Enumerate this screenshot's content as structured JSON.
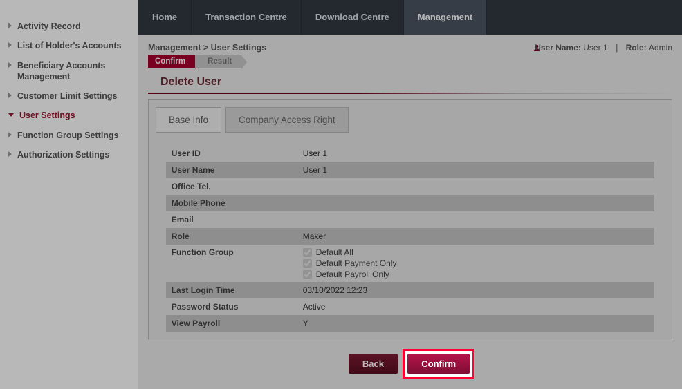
{
  "sidebar": {
    "items": [
      {
        "label": "Activity Record",
        "active": false
      },
      {
        "label": "List of Holder's Accounts",
        "active": false
      },
      {
        "label": "Beneficiary Accounts Management",
        "active": false
      },
      {
        "label": "Customer Limit Settings",
        "active": false
      },
      {
        "label": "User Settings",
        "active": true
      },
      {
        "label": "Function Group Settings",
        "active": false
      },
      {
        "label": "Authorization Settings",
        "active": false
      }
    ]
  },
  "topnav": {
    "items": [
      {
        "label": "Home",
        "active": false
      },
      {
        "label": "Transaction Centre",
        "active": false
      },
      {
        "label": "Download Centre",
        "active": false
      },
      {
        "label": "Management",
        "active": true
      }
    ]
  },
  "breadcrumb": {
    "text": "Management > User Settings"
  },
  "meta": {
    "user_name_label": "User Name:",
    "user_name_value": "User 1",
    "role_label": "Role:",
    "role_value": "Admin"
  },
  "wizard": {
    "confirm_label": "Confirm",
    "result_label": "Result"
  },
  "page": {
    "title": "Delete User"
  },
  "tabs": {
    "base_info": "Base Info",
    "company_access": "Company Access Right"
  },
  "info": {
    "rows": [
      {
        "label": "User ID",
        "value": "User 1",
        "shade": false
      },
      {
        "label": "User Name",
        "value": "User 1",
        "shade": true
      },
      {
        "label": "Office Tel.",
        "value": "",
        "shade": false
      },
      {
        "label": "Mobile Phone",
        "value": "",
        "shade": true
      },
      {
        "label": "Email",
        "value": "",
        "shade": false
      },
      {
        "label": "Role",
        "value": "Maker",
        "shade": true
      }
    ],
    "function_group_label": "Function Group",
    "function_groups": [
      {
        "label": "Default All",
        "checked": true
      },
      {
        "label": "Default Payment Only",
        "checked": true
      },
      {
        "label": "Default Payroll Only",
        "checked": true
      }
    ],
    "rows2": [
      {
        "label": "Last Login Time",
        "value": "03/10/2022 12:23",
        "shade": true
      },
      {
        "label": "Password Status",
        "value": "Active",
        "shade": false
      },
      {
        "label": "View Payroll",
        "value": "Y",
        "shade": true
      }
    ]
  },
  "buttons": {
    "back": "Back",
    "confirm": "Confirm"
  }
}
